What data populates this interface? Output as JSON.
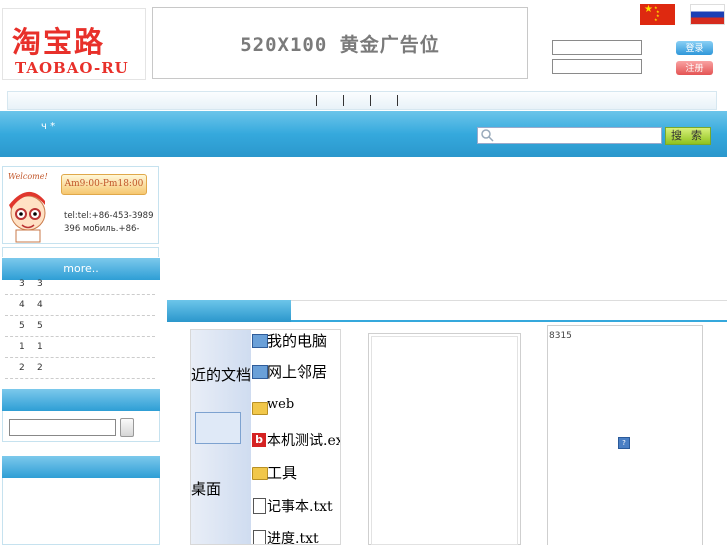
{
  "header": {
    "logo_cn": "淘宝路",
    "logo_en": "TAOBAO-RU",
    "banner_text": "520X100  黄金广告位",
    "login_button": "登录",
    "register_button": "注册",
    "flags": [
      "china-flag",
      "russia-flag"
    ]
  },
  "nav": {
    "separators": [
      "|",
      "|",
      "|",
      "|"
    ],
    "bluebar_text": "ч *",
    "search_button": "搜 索",
    "search_placeholder": ""
  },
  "sidebar": {
    "welcome": "Welcome!",
    "hours": "Am9:00-Pm18:00",
    "contact": "tel:tel:+86-453-3989396 мобиль.+86-",
    "more": "more..",
    "rows": [
      {
        "a": "3",
        "b": "3"
      },
      {
        "a": "4",
        "b": "4"
      },
      {
        "a": "5",
        "b": "5"
      },
      {
        "a": "1",
        "b": "1"
      },
      {
        "a": "2",
        "b": "2"
      }
    ]
  },
  "explorer": {
    "items": [
      "我的电脑",
      "网上邻居",
      "web",
      "本机测试.exe",
      "工具",
      "记事本.txt",
      "进度.txt"
    ],
    "left_items": [
      "近的文档",
      "桌面"
    ]
  },
  "main": {
    "counter": "8315",
    "placeholder_icon": "?"
  },
  "colors": {
    "accent_blue": "#35a9dd",
    "logo_red": "#e8302a",
    "search_green": "#8fc21f"
  }
}
